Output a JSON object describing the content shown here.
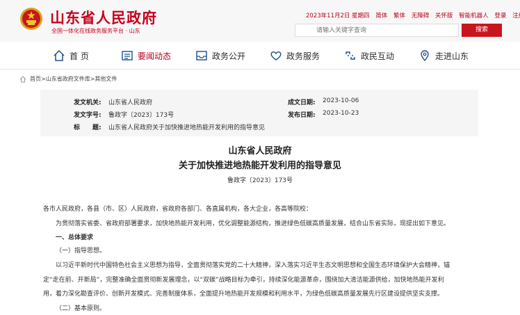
{
  "header": {
    "site_title": "山东省人民政府",
    "site_subtitle": "全国一体化在线政务服务平台 · 山东",
    "date": "2023年11月2日 星期四",
    "links": [
      "简体",
      "繁体",
      "无障碍",
      "关怀版",
      "智能机器人",
      "登录",
      "注册"
    ],
    "search_placeholder": "请输入关键字查询",
    "search_button": "搜索"
  },
  "nav": [
    {
      "label": "首 页",
      "icon": "home-icon"
    },
    {
      "label": "要闻动态",
      "icon": "news-icon"
    },
    {
      "label": "政务公开",
      "icon": "inbox-icon"
    },
    {
      "label": "政务服务",
      "icon": "heart-icon"
    },
    {
      "label": "政民互动",
      "icon": "chain-icon"
    },
    {
      "label": "走进山东",
      "icon": "location-icon"
    }
  ],
  "breadcrumb": "首页>山东省政府文件库>其他文件",
  "meta": {
    "issuer_label": "发文机关:",
    "issuer": "山东省人民政府",
    "doc_no_label": "发文字号:",
    "doc_no": "鲁政字〔2023〕173号",
    "subject_label": "标　　题:",
    "subject": "山东省人民政府关于加快推进地热能开发利用的指导意见",
    "written_label": "成文日期:",
    "written": "2023-10-06",
    "published_label": "发布日期:",
    "published": "2023-10-23"
  },
  "doc": {
    "title1": "山东省人民政府",
    "title2": "关于加快推进地热能开发利用的指导意见",
    "number": "鲁政字〔2023〕173号",
    "addressee": "各市人民政府，各县（市、区）人民政府，省政府各部门、各直属机构，各大企业，各高等院校：",
    "intro": "为贯彻落实省委、省政府部署要求，加快地热能开发利用，优化调整能源结构，推进绿色低碳高质量发展，结合山东省实际，现提出如下意见。",
    "section1": "一、总体要求",
    "sub1": "（一）指导思想。",
    "para1_l1": "以习近平新时代中国特色社会主义思想为指导，全面贯彻落实党的二十大精神，深入落实习近平生态文明思想和全国生态环境保护大会精神，锚",
    "para1_l2": "定“走在前、开新局”，完整准确全面贯彻新发展理念，以“双碳”战略目标为牵引，持续深化能源革命，围绕加大清洁能源供给，加快地热能开发利",
    "para1_l3": "用，着力深化勘查评价、创新开发模式、完善制度体系，全面提升地热能开发规模和利用水平，为绿色低碳高质量发展先行区建设提供坚实支撑。",
    "sub2": "（二）基本原则。"
  }
}
